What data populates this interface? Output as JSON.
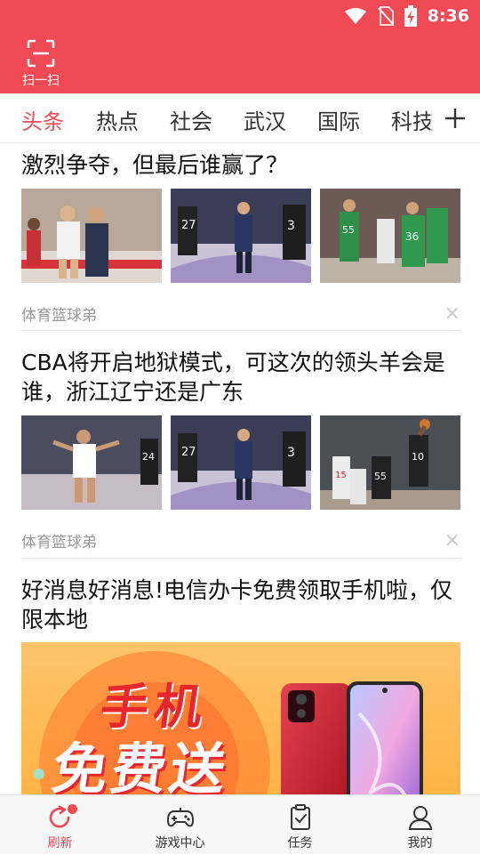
{
  "status_bar": {
    "time": "8:36",
    "icons": [
      "wifi-icon",
      "no-sim-icon",
      "battery-charging-icon"
    ]
  },
  "header": {
    "scan_label": "扫一扫",
    "scan_icon": "scan-icon",
    "color": "#f04b55"
  },
  "tabs": [
    {
      "label": "头条",
      "active": true
    },
    {
      "label": "热点",
      "active": false
    },
    {
      "label": "社会",
      "active": false
    },
    {
      "label": "武汉",
      "active": false
    },
    {
      "label": "国际",
      "active": false
    },
    {
      "label": "科技",
      "active": false
    }
  ],
  "tabs_more_icon": "plus-icon",
  "feed": {
    "articles": [
      {
        "title": "激烈争夺，但最后谁赢了？",
        "source": "体育篮球弟",
        "dismiss": "×"
      },
      {
        "title": "CBA将开启地狱模式，可这次的领头羊会是谁，浙江辽宁还是广东",
        "source": "体育篮球弟",
        "dismiss": "×"
      },
      {
        "title": "好消息好消息!电信办卡免费领取手机啦，仅限本地"
      }
    ],
    "ad_banner": {
      "line1": "手机",
      "line2": "免费送"
    }
  },
  "bottom_nav": [
    {
      "label": "刷新",
      "icon": "refresh-icon",
      "active": true,
      "badge": true
    },
    {
      "label": "游戏中心",
      "icon": "gamepad-icon",
      "active": false
    },
    {
      "label": "任务",
      "icon": "task-clipboard-icon",
      "active": false
    },
    {
      "label": "我的",
      "icon": "user-icon",
      "active": false
    }
  ]
}
